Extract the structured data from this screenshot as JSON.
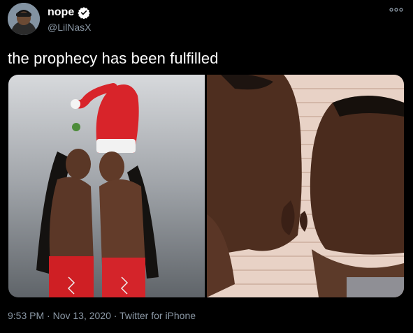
{
  "author": {
    "display_name": "nope",
    "handle": "@LilNasX",
    "verified": true,
    "avatar_icon": "user-avatar-photo"
  },
  "tweet": {
    "text": "the prophecy has been fulfilled",
    "media": [
      {
        "description_icon": "photo-two-people-santa-hat"
      },
      {
        "description_icon": "photo-two-men-kissing"
      }
    ]
  },
  "meta": {
    "time": "9:53 PM",
    "separator": " · ",
    "date": "Nov 13, 2020",
    "source": "Twitter for iPhone"
  },
  "icons": {
    "more": "more-options-icon",
    "verified": "verified-badge-icon"
  },
  "colors": {
    "background": "#000000",
    "text_primary": "#ffffff",
    "text_secondary": "#8b98a5",
    "verified_badge": "#ffffff"
  }
}
